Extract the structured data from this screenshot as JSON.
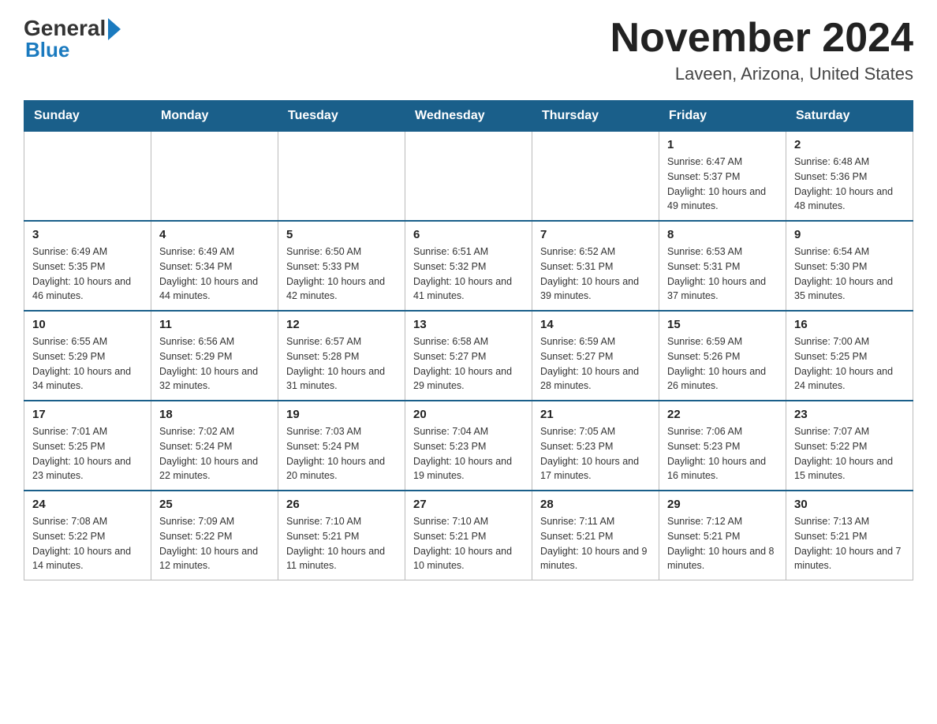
{
  "header": {
    "logo_general": "General",
    "logo_blue": "Blue",
    "title": "November 2024",
    "subtitle": "Laveen, Arizona, United States"
  },
  "days_of_week": [
    "Sunday",
    "Monday",
    "Tuesday",
    "Wednesday",
    "Thursday",
    "Friday",
    "Saturday"
  ],
  "weeks": [
    [
      {
        "day": "",
        "info": ""
      },
      {
        "day": "",
        "info": ""
      },
      {
        "day": "",
        "info": ""
      },
      {
        "day": "",
        "info": ""
      },
      {
        "day": "",
        "info": ""
      },
      {
        "day": "1",
        "info": "Sunrise: 6:47 AM\nSunset: 5:37 PM\nDaylight: 10 hours and 49 minutes."
      },
      {
        "day": "2",
        "info": "Sunrise: 6:48 AM\nSunset: 5:36 PM\nDaylight: 10 hours and 48 minutes."
      }
    ],
    [
      {
        "day": "3",
        "info": "Sunrise: 6:49 AM\nSunset: 5:35 PM\nDaylight: 10 hours and 46 minutes."
      },
      {
        "day": "4",
        "info": "Sunrise: 6:49 AM\nSunset: 5:34 PM\nDaylight: 10 hours and 44 minutes."
      },
      {
        "day": "5",
        "info": "Sunrise: 6:50 AM\nSunset: 5:33 PM\nDaylight: 10 hours and 42 minutes."
      },
      {
        "day": "6",
        "info": "Sunrise: 6:51 AM\nSunset: 5:32 PM\nDaylight: 10 hours and 41 minutes."
      },
      {
        "day": "7",
        "info": "Sunrise: 6:52 AM\nSunset: 5:31 PM\nDaylight: 10 hours and 39 minutes."
      },
      {
        "day": "8",
        "info": "Sunrise: 6:53 AM\nSunset: 5:31 PM\nDaylight: 10 hours and 37 minutes."
      },
      {
        "day": "9",
        "info": "Sunrise: 6:54 AM\nSunset: 5:30 PM\nDaylight: 10 hours and 35 minutes."
      }
    ],
    [
      {
        "day": "10",
        "info": "Sunrise: 6:55 AM\nSunset: 5:29 PM\nDaylight: 10 hours and 34 minutes."
      },
      {
        "day": "11",
        "info": "Sunrise: 6:56 AM\nSunset: 5:29 PM\nDaylight: 10 hours and 32 minutes."
      },
      {
        "day": "12",
        "info": "Sunrise: 6:57 AM\nSunset: 5:28 PM\nDaylight: 10 hours and 31 minutes."
      },
      {
        "day": "13",
        "info": "Sunrise: 6:58 AM\nSunset: 5:27 PM\nDaylight: 10 hours and 29 minutes."
      },
      {
        "day": "14",
        "info": "Sunrise: 6:59 AM\nSunset: 5:27 PM\nDaylight: 10 hours and 28 minutes."
      },
      {
        "day": "15",
        "info": "Sunrise: 6:59 AM\nSunset: 5:26 PM\nDaylight: 10 hours and 26 minutes."
      },
      {
        "day": "16",
        "info": "Sunrise: 7:00 AM\nSunset: 5:25 PM\nDaylight: 10 hours and 24 minutes."
      }
    ],
    [
      {
        "day": "17",
        "info": "Sunrise: 7:01 AM\nSunset: 5:25 PM\nDaylight: 10 hours and 23 minutes."
      },
      {
        "day": "18",
        "info": "Sunrise: 7:02 AM\nSunset: 5:24 PM\nDaylight: 10 hours and 22 minutes."
      },
      {
        "day": "19",
        "info": "Sunrise: 7:03 AM\nSunset: 5:24 PM\nDaylight: 10 hours and 20 minutes."
      },
      {
        "day": "20",
        "info": "Sunrise: 7:04 AM\nSunset: 5:23 PM\nDaylight: 10 hours and 19 minutes."
      },
      {
        "day": "21",
        "info": "Sunrise: 7:05 AM\nSunset: 5:23 PM\nDaylight: 10 hours and 17 minutes."
      },
      {
        "day": "22",
        "info": "Sunrise: 7:06 AM\nSunset: 5:23 PM\nDaylight: 10 hours and 16 minutes."
      },
      {
        "day": "23",
        "info": "Sunrise: 7:07 AM\nSunset: 5:22 PM\nDaylight: 10 hours and 15 minutes."
      }
    ],
    [
      {
        "day": "24",
        "info": "Sunrise: 7:08 AM\nSunset: 5:22 PM\nDaylight: 10 hours and 14 minutes."
      },
      {
        "day": "25",
        "info": "Sunrise: 7:09 AM\nSunset: 5:22 PM\nDaylight: 10 hours and 12 minutes."
      },
      {
        "day": "26",
        "info": "Sunrise: 7:10 AM\nSunset: 5:21 PM\nDaylight: 10 hours and 11 minutes."
      },
      {
        "day": "27",
        "info": "Sunrise: 7:10 AM\nSunset: 5:21 PM\nDaylight: 10 hours and 10 minutes."
      },
      {
        "day": "28",
        "info": "Sunrise: 7:11 AM\nSunset: 5:21 PM\nDaylight: 10 hours and 9 minutes."
      },
      {
        "day": "29",
        "info": "Sunrise: 7:12 AM\nSunset: 5:21 PM\nDaylight: 10 hours and 8 minutes."
      },
      {
        "day": "30",
        "info": "Sunrise: 7:13 AM\nSunset: 5:21 PM\nDaylight: 10 hours and 7 minutes."
      }
    ]
  ]
}
